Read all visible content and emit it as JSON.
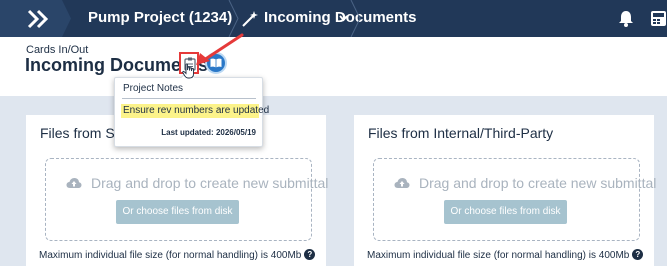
{
  "nav": {
    "project": "Pump Project (1234)",
    "current_page": "Incoming Documents",
    "icons": {
      "home": "double-chevron-icon",
      "page": "magic-wand-icon",
      "dropdown": "chevron-down-icon",
      "notifications": "bell-icon",
      "calculator": "calculator-icon"
    }
  },
  "header": {
    "section": "Cards In/Out",
    "title": "Incoming Documents",
    "icons": {
      "notes": "clipboard-icon",
      "guide": "book-icon"
    }
  },
  "popover": {
    "title": "Project Notes",
    "note": "Ensure rev numbers are updated",
    "last_updated_label": "Last updated:",
    "last_updated_date": "2026/05/19"
  },
  "panels": [
    {
      "title": "Files from Su",
      "dropzone_text": "Drag and drop to create new submittal",
      "choose_button": "Or choose files from disk",
      "max_size_text": "Maximum individual file size (for normal handling) is 400Mb"
    },
    {
      "title": "Files from Internal/Third-Party",
      "dropzone_text": "Drag and drop to create new submittal",
      "choose_button": "Or choose files from disk",
      "max_size_text": "Maximum individual file size (for normal handling) is 400Mb"
    }
  ],
  "colors": {
    "nav_bg": "#213858",
    "highlight": "#fcf38a",
    "annotation_red": "#e53a3a",
    "button_disabled": "#a6c3cf",
    "content_bg": "#dfe6ef"
  }
}
